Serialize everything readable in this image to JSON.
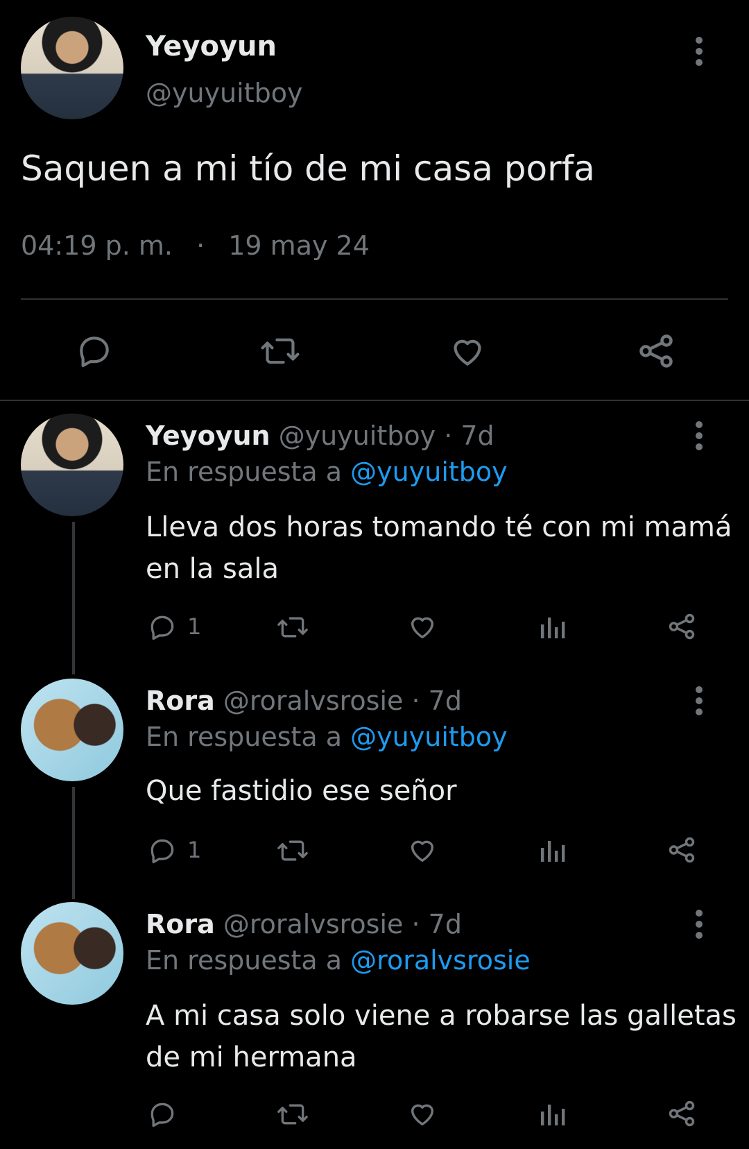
{
  "main_tweet": {
    "display_name": "Yeyoyun",
    "handle": "@yuyuitboy",
    "text": "Saquen a mi tío de mi casa porfa",
    "time": "04:19 p. m.",
    "separator": "·",
    "date": "19 may 24"
  },
  "replies": [
    {
      "display_name": "Yeyoyun",
      "handle": "@yuyuitboy",
      "age": "· 7d",
      "reply_prefix": "En respuesta a",
      "reply_to": "@yuyuitboy",
      "text_line1": "Lleva dos horas tomando té con mi mamá",
      "text_line2": "en la sala",
      "reply_count": "1"
    },
    {
      "display_name": "Rora",
      "handle": "@roralvsrosie",
      "age": "· 7d",
      "reply_prefix": "En respuesta a",
      "reply_to": "@yuyuitboy",
      "text_line1": "Que fastidio ese señor",
      "reply_count": "1"
    },
    {
      "display_name": "Rora",
      "handle": "@roralvsrosie",
      "age": "· 7d",
      "reply_prefix": "En respuesta a",
      "reply_to": "@roralvsrosie",
      "text_line1": "A mi casa solo viene a robarse las galletas",
      "text_line2": "de mi hermana",
      "reply_count": ""
    }
  ],
  "icons": [
    "more-vertical-icon",
    "reply-icon",
    "retweet-icon",
    "like-icon",
    "views-icon",
    "share-icon"
  ],
  "colors": {
    "background": "#000000",
    "text": "#e7e9ea",
    "muted": "#71767b",
    "link": "#1d9bf0"
  }
}
